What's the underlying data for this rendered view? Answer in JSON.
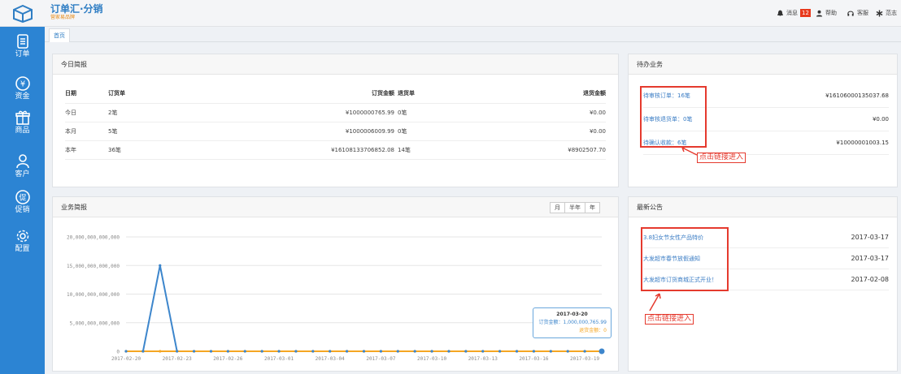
{
  "app": {
    "title": "订单汇·分销",
    "subtitle": "营家易品牌"
  },
  "topnav": {
    "messages_label": "消息",
    "messages_badge": "12",
    "help_label": "帮助",
    "service_label": "客服",
    "theme_label": "范志"
  },
  "sidebar": {
    "items": [
      {
        "label": "订单",
        "icon": "order-icon"
      },
      {
        "label": "资金",
        "icon": "yuan-circle-icon"
      },
      {
        "label": "商品",
        "icon": "gift-icon"
      },
      {
        "label": "客户",
        "icon": "user-icon"
      },
      {
        "label": "促销",
        "icon": "promo-icon"
      },
      {
        "label": "配置",
        "icon": "gear-icon"
      }
    ]
  },
  "tabs": {
    "home": "首页"
  },
  "daily": {
    "title": "今日简报",
    "headers": [
      "日期",
      "订货单",
      "订货金额",
      "退货单",
      "退货金额"
    ],
    "rows": [
      [
        "今日",
        "2笔",
        "¥1000000765.99",
        "0笔",
        "¥0.00"
      ],
      [
        "本月",
        "5笔",
        "¥1000006009.99",
        "0笔",
        "¥0.00"
      ],
      [
        "本年",
        "36笔",
        "¥16108133706852.08",
        "14笔",
        "¥8902507.70"
      ]
    ]
  },
  "todo": {
    "title": "待办业务",
    "items": [
      {
        "label": "待审核订单：16笔",
        "value": "¥16106000135037.68"
      },
      {
        "label": "待审核退货单：0笔",
        "value": "¥0.00"
      },
      {
        "label": "待确认收款：6笔",
        "value": "¥10000001003.15"
      }
    ],
    "callout": "点击链接进入"
  },
  "business": {
    "title": "业务简报",
    "periods": [
      "月",
      "半年",
      "年"
    ],
    "tooltip": {
      "date": "2017-03-20",
      "line1": "订货金额：1,000,000,765.99",
      "line2": "退货金额：0"
    }
  },
  "notices": {
    "title": "最新公告",
    "items": [
      {
        "label": "3.8妇女节女性产品特价",
        "date": "2017-03-17"
      },
      {
        "label": "大发超市春节放假通知",
        "date": "2017-03-17"
      },
      {
        "label": "大发超市订货商城正式开业！",
        "date": "2017-02-08"
      }
    ],
    "callout": "点击链接进入"
  },
  "colors": {
    "sidebar": "#2c84d3",
    "order_line": "#3d86cc",
    "return_line": "#f5a623",
    "callout": "#e53a2e"
  },
  "chart_data": {
    "type": "line",
    "ylim": [
      0,
      20000000000000
    ],
    "yticks": [
      "0",
      "5,000,000,000,000",
      "10,000,000,000,000",
      "15,000,000,000,000",
      "20,000,000,000,000"
    ],
    "x": [
      "2017-02-20",
      "2017-02-21",
      "2017-02-22",
      "2017-02-23",
      "2017-02-24",
      "2017-02-25",
      "2017-02-26",
      "2017-02-27",
      "2017-02-28",
      "2017-03-01",
      "2017-03-02",
      "2017-03-03",
      "2017-03-04",
      "2017-03-05",
      "2017-03-06",
      "2017-03-07",
      "2017-03-08",
      "2017-03-09",
      "2017-03-10",
      "2017-03-11",
      "2017-03-12",
      "2017-03-13",
      "2017-03-14",
      "2017-03-15",
      "2017-03-16",
      "2017-03-17",
      "2017-03-18",
      "2017-03-19",
      "2017-03-20"
    ],
    "xticks": [
      "2017-02-20",
      "2017-02-23",
      "2017-02-26",
      "2017-03-01",
      "2017-03-04",
      "2017-03-07",
      "2017-03-10",
      "2017-03-13",
      "2017-03-16",
      "2017-03-19"
    ],
    "series": [
      {
        "name": "订货金额",
        "values": [
          0,
          0,
          15000000000000,
          0,
          0,
          0,
          0,
          0,
          0,
          0,
          0,
          0,
          0,
          0,
          0,
          0,
          0,
          0,
          0,
          0,
          0,
          0,
          0,
          0,
          0,
          0,
          0,
          0,
          1000000765.99
        ]
      },
      {
        "name": "退货金额",
        "values": [
          0,
          0,
          0,
          0,
          0,
          0,
          0,
          0,
          0,
          0,
          0,
          0,
          0,
          0,
          0,
          0,
          0,
          0,
          0,
          0,
          0,
          0,
          0,
          0,
          0,
          0,
          0,
          0,
          0
        ]
      }
    ]
  }
}
